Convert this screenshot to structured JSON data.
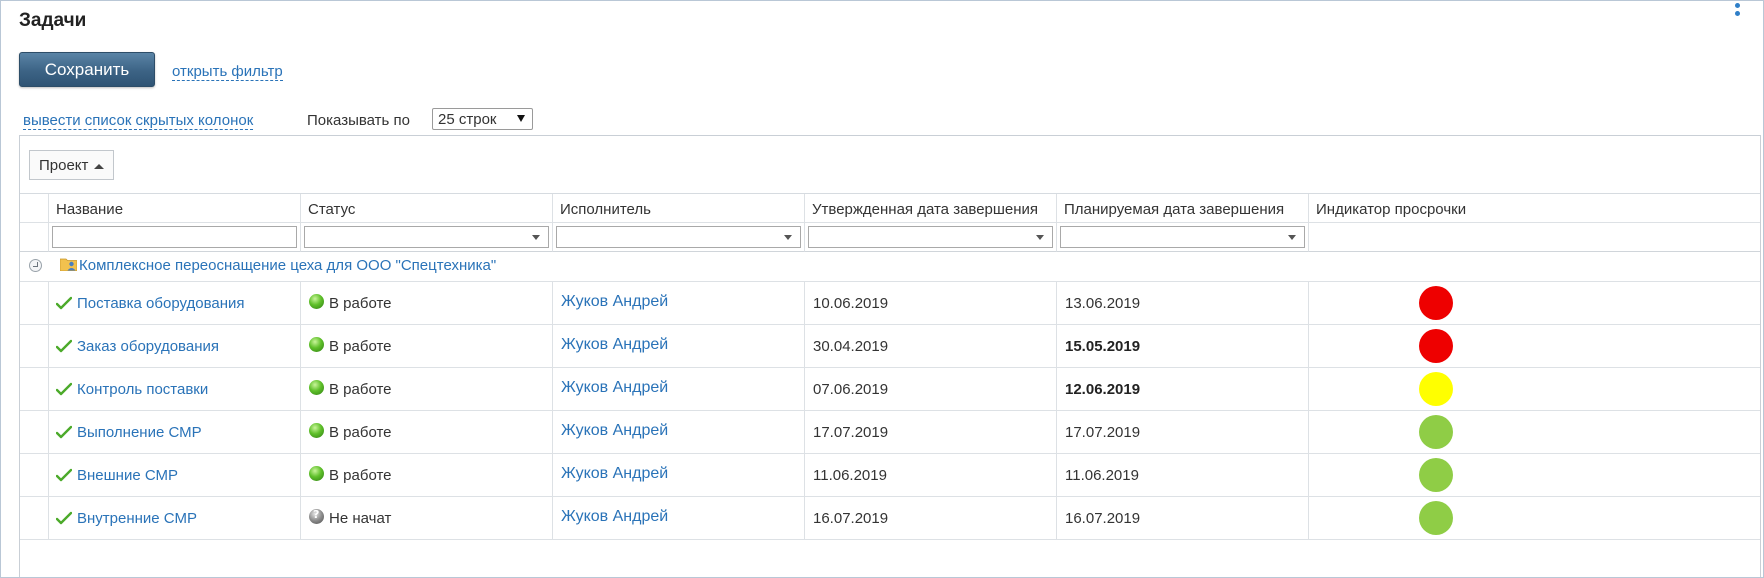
{
  "page": {
    "title": "Задачи"
  },
  "toolbar": {
    "save_label": "Сохранить",
    "filter_link": "открыть фильтр",
    "hidden_columns_link": "вывести список скрытых колонок",
    "show_label": "Показывать по",
    "rows_per_page": "25 строк"
  },
  "grouping": {
    "chip_label": "Проект"
  },
  "columns": [
    "Название",
    "Статус",
    "Исполнитель",
    "Утвержденная дата завершения",
    "Планируемая дата завершения",
    "Индикатор просрочки"
  ],
  "colors": {
    "link": "#2a73b8",
    "red": "#ee0000",
    "yellow": "#ffff00",
    "green": "#8fcd46"
  },
  "group": {
    "title": "Комплексное переоснащение цеха для ООО \"Спецтехника\"",
    "icon": "project-folder-icon"
  },
  "rows": [
    {
      "name": "Поставка оборудования",
      "status": "В работе",
      "status_type": "in-progress",
      "assignee": "Жуков Андрей",
      "approved_date": "10.06.2019",
      "planned_date": "13.06.2019",
      "planned_bold": false,
      "indicator": "red"
    },
    {
      "name": "Заказ оборудования",
      "status": "В работе",
      "status_type": "in-progress",
      "assignee": "Жуков Андрей",
      "approved_date": "30.04.2019",
      "planned_date": "15.05.2019",
      "planned_bold": true,
      "indicator": "red"
    },
    {
      "name": "Контроль поставки",
      "status": "В работе",
      "status_type": "in-progress",
      "assignee": "Жуков Андрей",
      "approved_date": "07.06.2019",
      "planned_date": "12.06.2019",
      "planned_bold": true,
      "indicator": "yellow"
    },
    {
      "name": "Выполнение СМР",
      "status": "В работе",
      "status_type": "in-progress",
      "assignee": "Жуков Андрей",
      "approved_date": "17.07.2019",
      "planned_date": "17.07.2019",
      "planned_bold": false,
      "indicator": "green"
    },
    {
      "name": "Внешние СМР",
      "status": "В работе",
      "status_type": "in-progress",
      "assignee": "Жуков Андрей",
      "approved_date": "11.06.2019",
      "planned_date": "11.06.2019",
      "planned_bold": false,
      "indicator": "green"
    },
    {
      "name": "Внутренние СМР",
      "status": "Не начат",
      "status_type": "not-started",
      "assignee": "Жуков Андрей",
      "approved_date": "16.07.2019",
      "planned_date": "16.07.2019",
      "planned_bold": false,
      "indicator": "green"
    }
  ]
}
